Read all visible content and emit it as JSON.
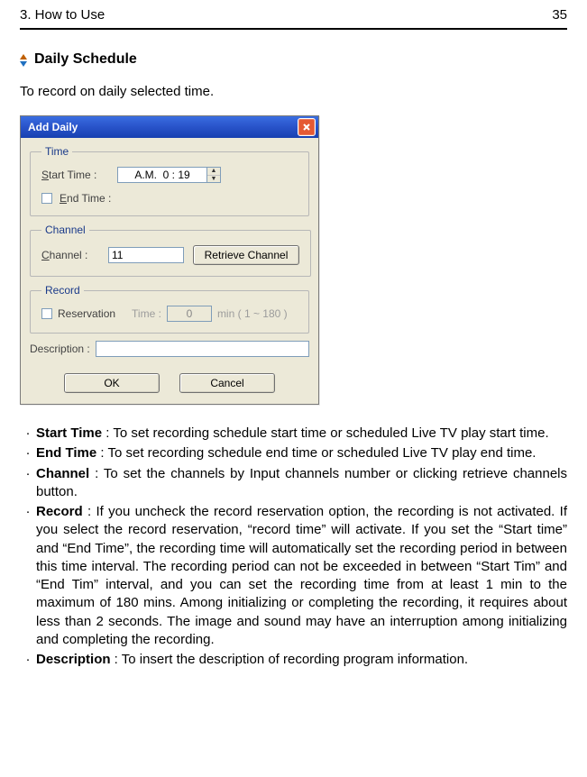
{
  "header": {
    "left": "3.    How to Use",
    "right": "35"
  },
  "section": {
    "title": "Daily Schedule",
    "intro": "To record on daily selected time."
  },
  "dialog": {
    "title": "Add Daily",
    "groups": {
      "time": {
        "legend": "Time",
        "startLabelPrefix": "S",
        "startLabelRest": "tart Time :",
        "startValue": "A.M.  0 : 19",
        "endLabelPrefixGap": "",
        "endLabelUnderline": "E",
        "endLabelRest": "nd Time :"
      },
      "channel": {
        "legend": "Channel",
        "labelUnderline": "C",
        "labelRest": "hannel :",
        "value": "11",
        "retrieve": "Retrieve Channel"
      },
      "record": {
        "legend": "Record",
        "reservPrefix": "Reser",
        "reservUnderline": "v",
        "reservRest": "ation",
        "timeLabel": "Time :",
        "timeValue": "0",
        "timeSuffix": "min ( 1 ~ 180 )"
      },
      "description": {
        "labelPrefix": "Descri",
        "labelUnderline": "p",
        "labelRest": "tion :",
        "value": ""
      }
    },
    "buttons": {
      "ok": "OK",
      "cancel": "Cancel"
    }
  },
  "list": [
    {
      "term": "Start Time",
      "body": " : To set recording schedule start time or scheduled Live TV play start time."
    },
    {
      "term": "End Time",
      "body": " : To set recording schedule end time or scheduled Live TV play end time."
    },
    {
      "term": "Channel",
      "body": "  :  To set the channels by Input channels number or clicking retrieve channels button."
    },
    {
      "term": "Record",
      "body": "  : If you uncheck the record reservation option, the recording is not activated.  If you select the record reservation, “record time” will activate.  If you set the “Start time” and “End Time”, the recording time will automatically set the recording period in between this time interval.  The recording period can not be exceeded in between “Start Tim” and “End Tim” interval, and you can set the recording time from at least 1 min to the maximum of 180 mins.  Among initializing or completing the recording, it requires about less than 2 seconds.  The image and sound may have an interruption among initializing and completing the recording."
    },
    {
      "term": "Description",
      "body": " : To insert the description of recording program information."
    }
  ]
}
